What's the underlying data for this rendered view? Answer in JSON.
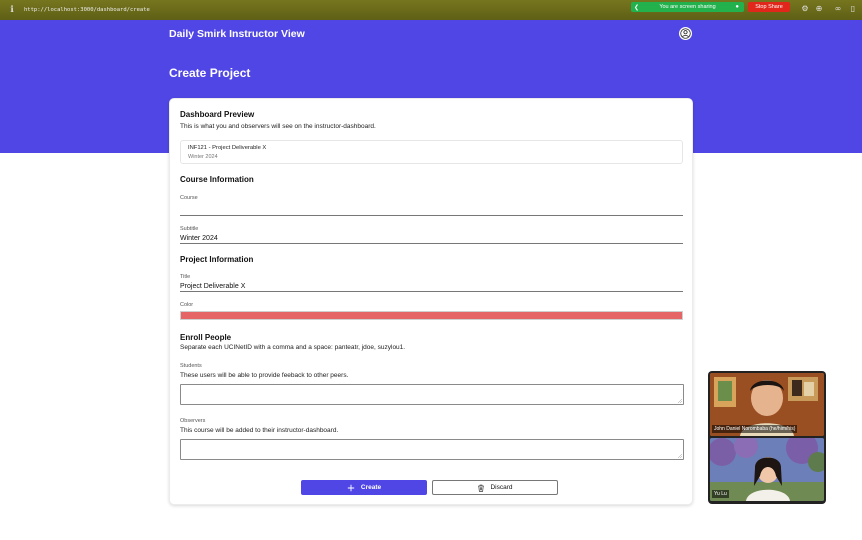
{
  "browser": {
    "url": "http://localhost:3000/dashboard/create",
    "sharing_text": "You are screen sharing",
    "stop_share_label": "Stop Share"
  },
  "header": {
    "app_title": "Daily Smirk Instructor View",
    "page_title": "Create Project"
  },
  "preview_section": {
    "heading": "Dashboard Preview",
    "description": "This is what you and observers will see on the instructor-dashboard.",
    "card_title": "INF121 - Project Deliverable X",
    "card_subtitle": "Winter 2024"
  },
  "course_section": {
    "heading": "Course Information",
    "course_label": "Course",
    "course_value": "",
    "subtitle_label": "Subtitle",
    "subtitle_value": "Winter 2024"
  },
  "project_section": {
    "heading": "Project Information",
    "title_label": "Title",
    "title_value": "Project Deliverable X",
    "color_label": "Color",
    "color_value": "#e56567"
  },
  "enroll_section": {
    "heading": "Enroll People",
    "description": "Separate each UCINetID with a comma and a space: panteatr, jdoe, suzylou1.",
    "students_label": "Students",
    "students_help": "These users will be able to provide feeback to other peers.",
    "observers_label": "Observers",
    "observers_help": "This course will be added to their instructor-dashboard."
  },
  "actions": {
    "create_label": "Create",
    "discard_label": "Discard"
  },
  "video": {
    "participant1": "John Daniel Norombaba (he/him/his)",
    "participant2": "Yu Lu"
  },
  "colors": {
    "primary": "#5046e5",
    "project_color": "#e56567",
    "sharing_green": "#22b14c",
    "stop_red": "#e1261c"
  },
  "icons": [
    "info-icon",
    "user-icon",
    "plus-icon",
    "trash-icon"
  ]
}
